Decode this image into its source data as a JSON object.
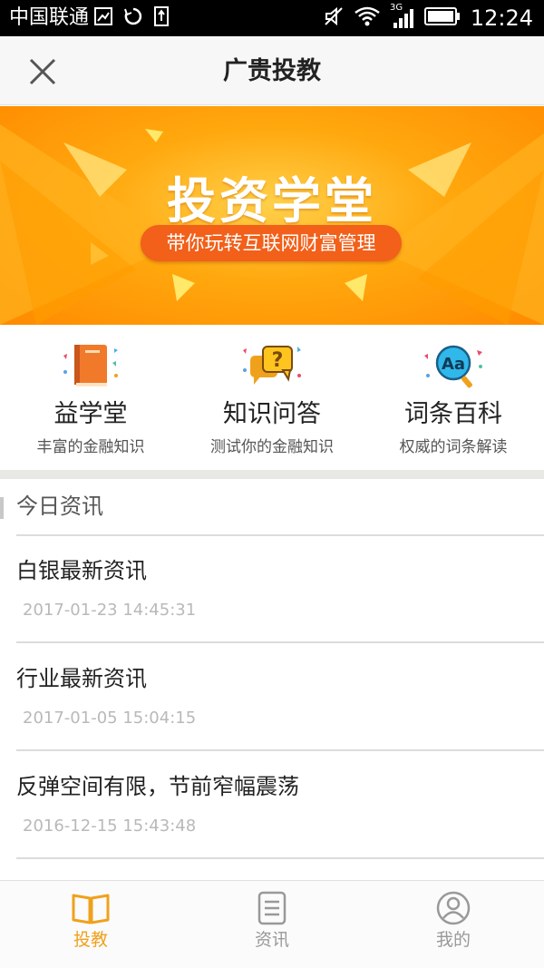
{
  "status_bar": {
    "carrier": "中国联通",
    "network": "3G",
    "time": "12:24"
  },
  "header": {
    "title": "广贵投教",
    "close_icon": "close-icon"
  },
  "banner": {
    "title": "投资学堂",
    "subtitle": "带你玩转互联网财富管理"
  },
  "features": [
    {
      "name": "益学堂",
      "desc": "丰富的金融知识",
      "icon": "book-icon"
    },
    {
      "name": "知识问答",
      "desc": "测试你的金融知识",
      "icon": "question-bubble-icon"
    },
    {
      "name": "词条百科",
      "desc": "权威的词条解读",
      "icon": "dictionary-search-icon"
    }
  ],
  "news_section": {
    "header": "今日资讯",
    "items": [
      {
        "title": "白银最新资讯",
        "date": "2017-01-23 14:45:31"
      },
      {
        "title": "行业最新资讯",
        "date": "2017-01-05 15:04:15"
      },
      {
        "title": "反弹空间有限，节前窄幅震荡",
        "date": "2016-12-15 15:43:48"
      }
    ]
  },
  "tabs": [
    {
      "label": "投教",
      "icon": "open-book-icon",
      "active": true
    },
    {
      "label": "资讯",
      "icon": "document-list-icon",
      "active": false
    },
    {
      "label": "我的",
      "icon": "user-profile-icon",
      "active": false
    }
  ],
  "colors": {
    "accent": "#f0a11c",
    "banner_orange": "#ff9a00",
    "pill_red": "#f2601a",
    "inactive_tab": "#999999"
  }
}
